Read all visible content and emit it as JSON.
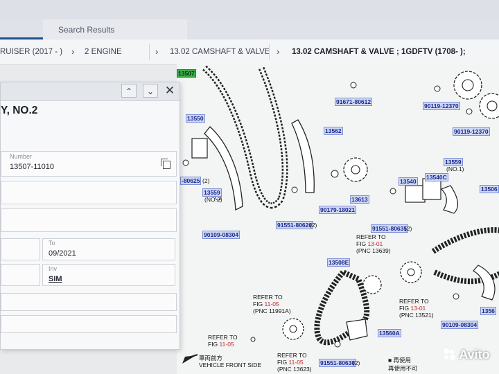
{
  "top_tabs": {
    "search_results": "Search Results"
  },
  "breadcrumb": [
    {
      "label": "RUISER (2017 - )"
    },
    {
      "label": "2 ENGINE"
    },
    {
      "label": "13.02 CAMSHAFT & VALVE"
    },
    {
      "label": "13.02 CAMSHAFT & VALVE ; 1GDFTV (1708- );"
    }
  ],
  "panel": {
    "title": "Y, NO.2",
    "number_label": "Number",
    "number_value": "13507-11010",
    "to_label": "To",
    "to_value": "09/2021",
    "inv_label": "Inv",
    "inv_value": "SIM",
    "controls": {
      "up": "⌃",
      "down": "⌄",
      "close": "✕"
    }
  },
  "diagram": {
    "labels": {
      "p13507": "13507",
      "p13550": "13550",
      "p13562": "13562",
      "p13559a": "13559",
      "p13559b": "13559",
      "p13613": "13613",
      "p13540": "13540",
      "p13540c": "13540C",
      "p13506": "13506",
      "p13508e": "13508E",
      "p13560a": "13560A",
      "p13561": "1356"
    },
    "bolts": {
      "b91671": "91671-80612",
      "b90119a": "90119-12370",
      "b90119b": "90119-12370",
      "b80625": "-80625",
      "b80625_qty": "(2)",
      "b90179": "90179-18021",
      "b91551a": "91551-80620",
      "b91551a_qty": "(2)",
      "b91551b": "91551-80635",
      "b91551b_qty": "(2)",
      "b90109a": "90109-08304",
      "b90109b": "90109-08304",
      "b91551c": "91551-80630",
      "b91551c_qty": "(2)"
    },
    "notes": {
      "no2": "(NO.2)",
      "no1": "(NO.1)",
      "ref_13_01_a": {
        "refer": "REFER TO",
        "fig": "FIG",
        "fignum": "13-01",
        "pnc": "(PNC 13639)"
      },
      "ref_13_01_b": {
        "refer": "REFER TO",
        "fig": "FIG",
        "fignum": "13-01",
        "pnc": "(PNC 13521)"
      },
      "ref_11_05_a": {
        "refer": "REFER TO",
        "fig": "FIG",
        "fignum": "11-05",
        "pnc": "(PNC 11991A)"
      },
      "ref_11_05_b": {
        "refer": "REFER TO",
        "fig": "FIG",
        "fignum": "11-05"
      },
      "ref_11_05_c": {
        "refer": "REFER TO",
        "fig": "FIG",
        "fignum": "11-05",
        "pnc": "(PNC 13623)"
      },
      "vehicle_cn": "車両前方",
      "vehicle_front": "VEHICLE FRONT SIDE",
      "reuse_cn": "再使用不可",
      "prev_cn": "■ 再使用"
    }
  },
  "watermark": {
    "brand": "Avito"
  }
}
